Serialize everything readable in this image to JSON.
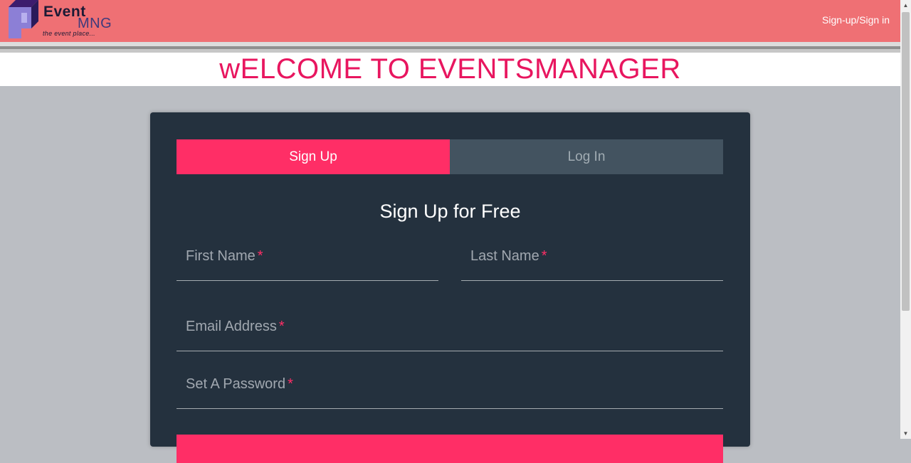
{
  "header": {
    "logo": {
      "word1": "Event",
      "word2": "MNG",
      "tagline": "the event place..."
    },
    "nav_link": "Sign-up/Sign in"
  },
  "welcome": {
    "title": "wELCOME TO EVENTSMANAGER"
  },
  "form": {
    "tabs": [
      {
        "label": "Sign Up",
        "active": true
      },
      {
        "label": "Log In",
        "active": false
      }
    ],
    "heading": "Sign Up for Free",
    "fields": {
      "first_name": {
        "label": "First Name",
        "required_mark": "*"
      },
      "last_name": {
        "label": "Last Name",
        "required_mark": "*"
      },
      "email": {
        "label": "Email Address",
        "required_mark": "*"
      },
      "password": {
        "label": "Set A Password",
        "required_mark": "*"
      }
    }
  },
  "colors": {
    "header_bg": "#ef7074",
    "accent": "#ff2e66",
    "welcome_text": "#e8165f",
    "card_bg": "#24313e",
    "inactive_tab": "#435360",
    "page_bg": "#bbbec3"
  }
}
